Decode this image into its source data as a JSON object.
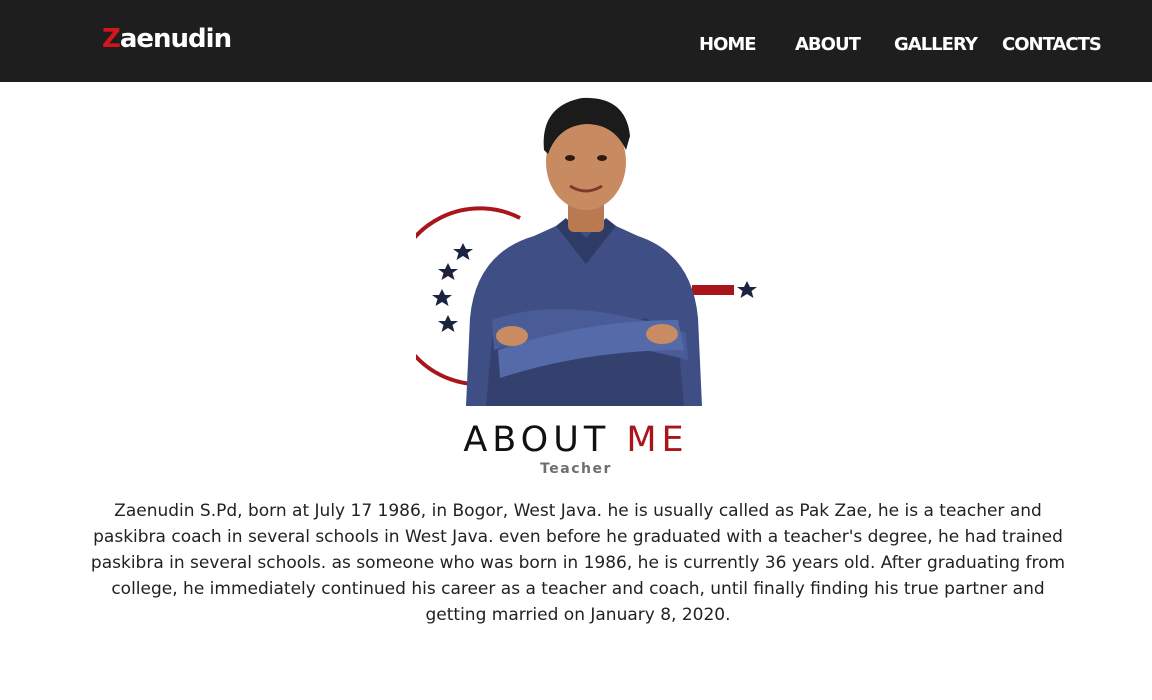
{
  "brand": {
    "first_letter": "Z",
    "rest": "aenudin"
  },
  "nav": {
    "items": [
      "HOME",
      "ABOUT",
      "GALLERY",
      "CONTACTS"
    ]
  },
  "hero": {
    "photo_subject": "portrait of a man in blue shirt with arms crossed",
    "accent_color": "#a8161b",
    "star_color": "#1c2340"
  },
  "about": {
    "title_main": "ABOUT ",
    "title_accent": "ME",
    "subtitle": "Teacher",
    "bio": "Zaenudin S.Pd, born at July 17 1986, in Bogor, West Java. he is usually called as Pak Zae, he is a teacher and paskibra coach in several schools in West Java. even before he graduated with a teacher's degree, he had trained paskibra in several schools. as someone who was born in 1986, he is currently 36 years old. After graduating from college, he immediately continued his career as a teacher and coach, until finally finding his true partner and getting married on January 8, 2020."
  }
}
